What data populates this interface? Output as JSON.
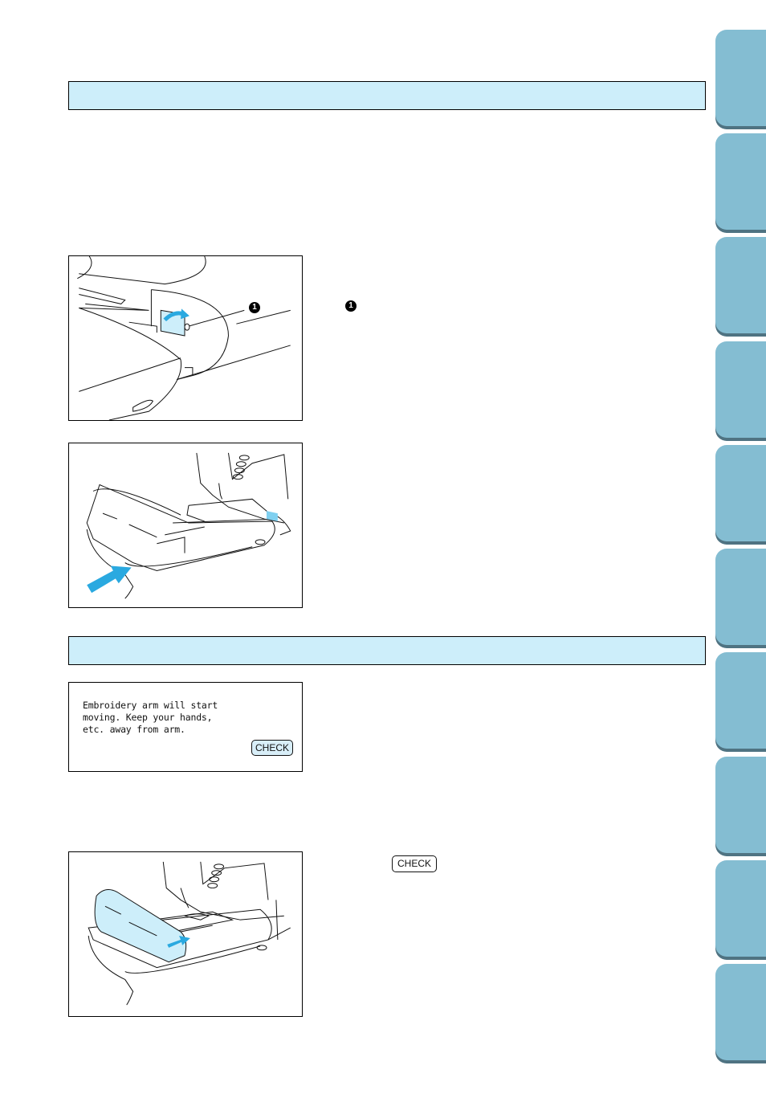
{
  "sections": [
    {
      "title": ""
    },
    {
      "title": ""
    }
  ],
  "figures": [
    {
      "id": "fig-release-lever",
      "callout": "1"
    },
    {
      "id": "fig-attach-unit"
    },
    {
      "id": "fig-arm-moving"
    }
  ],
  "step_callout": {
    "number": "1"
  },
  "screen": {
    "message_line1": "Embroidery arm will start",
    "message_line2": "moving. Keep your hands,",
    "message_line3": "etc. away from arm.",
    "button_label": "CHECK"
  },
  "inline_button": {
    "label": "CHECK"
  },
  "side_tabs": [
    {
      "label": ""
    },
    {
      "label": ""
    },
    {
      "label": ""
    },
    {
      "label": ""
    },
    {
      "label": ""
    },
    {
      "label": ""
    },
    {
      "label": ""
    },
    {
      "label": ""
    },
    {
      "label": ""
    },
    {
      "label": ""
    }
  ],
  "colors": {
    "section_bar": "#cdeefa",
    "side_tab": "#84bdd2",
    "side_tab_shadow": "#4f7382",
    "highlight_blue": "#2aa9e0"
  }
}
